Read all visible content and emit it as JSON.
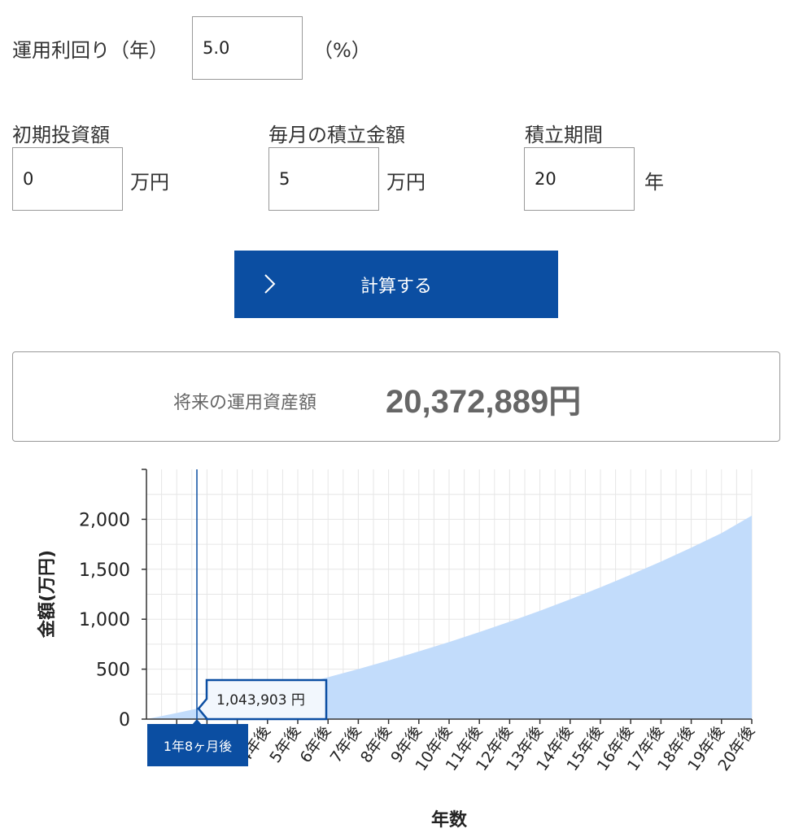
{
  "form": {
    "rate_label": "運用利回り（年）",
    "rate_value": "5.0",
    "rate_unit": "（%）",
    "initial_label": "初期投資額",
    "initial_value": "0",
    "initial_unit": "万円",
    "monthly_label": "毎月の積立金額",
    "monthly_value": "5",
    "monthly_unit": "万円",
    "period_label": "積立期間",
    "period_value": "20",
    "period_unit": "年",
    "calc_button": "計算する"
  },
  "result": {
    "label": "将来の運用資産額",
    "value": "20,372,889円"
  },
  "colors": {
    "button": "#0b4ea2",
    "area_fill": "#c2dcfb",
    "cursor_line": "#0b4ea2",
    "tooltip_border": "#0b4ea2",
    "tooltip_bg": "#f2f7fd"
  },
  "chart_data": {
    "type": "area",
    "xlabel": "年数",
    "ylabel": "金額(万円)",
    "ylim": [
      0,
      2500
    ],
    "yticks": [
      0,
      500,
      1000,
      1500,
      2000
    ],
    "ytick_labels": [
      "0",
      "500",
      "1,000",
      "1,500",
      "2,000"
    ],
    "grid": true,
    "x_categories": [
      "1年後",
      "2年後",
      "3年後",
      "4年後",
      "5年後",
      "6年後",
      "7年後",
      "8年後",
      "9年後",
      "10年後",
      "11年後",
      "12年後",
      "13年後",
      "14年後",
      "15年後",
      "16年後",
      "17年後",
      "18年後",
      "19年後",
      "20年後"
    ],
    "x_years": [
      0,
      1,
      2,
      3,
      4,
      5,
      6,
      7,
      8,
      9,
      10,
      11,
      12,
      13,
      14,
      15,
      16,
      17,
      18,
      19,
      20
    ],
    "values": [
      0,
      61,
      126,
      194,
      266,
      340,
      419,
      501,
      587,
      678,
      772,
      871,
      975,
      1084,
      1199,
      1319,
      1445,
      1577,
      1716,
      1862,
      2037
    ],
    "cursor": {
      "x_label": "1年8ヶ月後",
      "x_years": 1.667,
      "tooltip": "1,043,903 円",
      "value": 104.4
    }
  }
}
